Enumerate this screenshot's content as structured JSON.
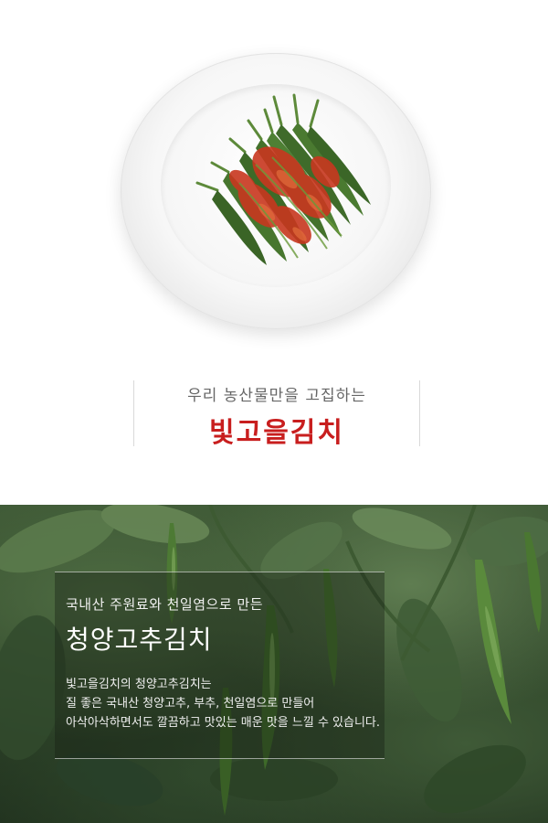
{
  "header": {
    "subtitle": "우리 농산물만을 고집하는",
    "brand": "빛고을김치",
    "brand_color": "#c81e1e"
  },
  "product_image": {
    "icon": "plate-of-green-pepper-kimchi"
  },
  "info": {
    "lead": "국내산 주원료와 천일염으로 만든",
    "title": "청양고추김치",
    "body": [
      "빛고을김치의 청양고추김치는",
      "질 좋은 국내산 청양고추, 부추, 천일염으로 만들어",
      "아삭아삭하면서도 깔끔하고 맛있는 매운 맛을 느낄 수 있습니다."
    ]
  },
  "background_image": {
    "icon": "green-pepper-field"
  }
}
